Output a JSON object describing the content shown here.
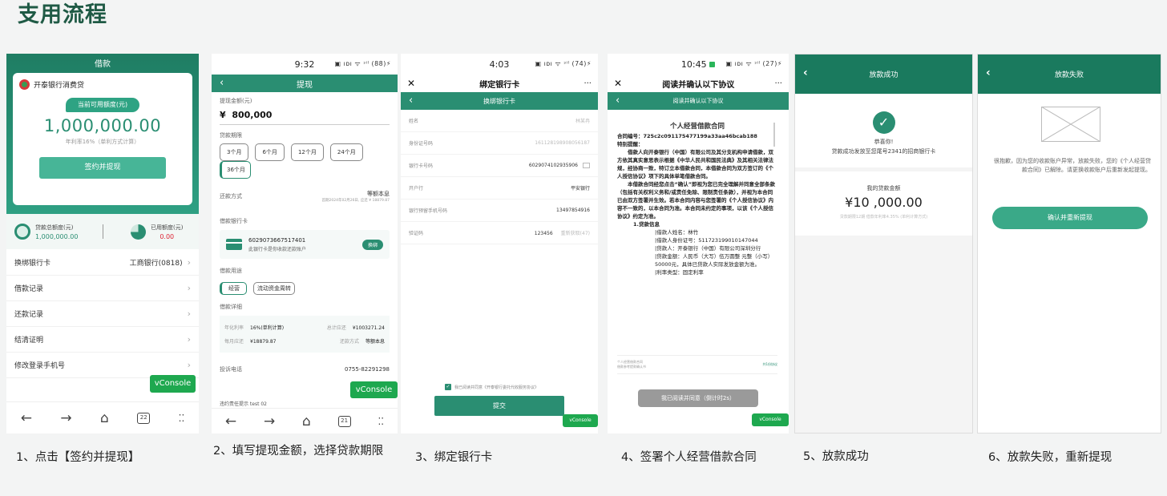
{
  "page_title": "支用流程",
  "captions": [
    "1、点击【签约并提现】",
    "2、填写提现金额，选择贷款期限",
    "3、绑定银行卡",
    "4、签署个人经营借款合同",
    "5、放款成功",
    "6、放款失败，重新提现"
  ],
  "vconsole": "vConsole",
  "p1": {
    "nav_title": "借款",
    "bank_name": "开泰银行消费贷",
    "quota_label": "当前可用额度(元)",
    "quota": "1,000,000.00",
    "rate_note": "年利率16%（单利方式计算）",
    "sign_button": "签约并提现",
    "total_label": "贷款总额度(元)",
    "total_value": "1,000,000.00",
    "used_label": "已用额度(元)",
    "used_value": "0.00",
    "menu": [
      {
        "label": "换绑银行卡",
        "value": "工商银行(0818)"
      },
      {
        "label": "借款记录",
        "value": ""
      },
      {
        "label": "还款记录",
        "value": ""
      },
      {
        "label": "结清证明",
        "value": ""
      },
      {
        "label": "修改登录手机号",
        "value": ""
      }
    ],
    "tab_count": "22"
  },
  "p2": {
    "time": "9:32",
    "status_right": "▣ ıᴅı ᯤ ᵌⁱˡ (88)⚡",
    "nav_title": "提现",
    "amount_label": "提现金额(元)",
    "currency": "¥",
    "amount": "800,000",
    "term_label": "贷款期限",
    "terms": [
      "3个月",
      "6个月",
      "12个月",
      "24个月",
      "36个月"
    ],
    "repay_label": "还款方式",
    "repay_value": "等额本息",
    "repay_note": "首期2024年02月26日, 应还 ¥ 18879.87",
    "card_label": "借款银行卡",
    "card_no": "6029073667517401",
    "card_note": "此银行卡是你收款还款账户",
    "card_btn": "换绑",
    "use_label": "借款用途",
    "uses": [
      "经营",
      "流动资金周转"
    ],
    "detail_label": "借款详细",
    "d_rate_l": "年化利率",
    "d_rate_v": "16%(单利计算)",
    "d_total_l": "总计应还",
    "d_total_v": "¥1003271.24",
    "d_month_l": "每月应还",
    "d_month_v": "¥18879.87",
    "d_way_l": "还款方式",
    "d_way_v": "等额本息",
    "phone_label": "投诉电话",
    "phone_value": "0755-82291298",
    "footer_note": "违约责任提示 test 02",
    "tab_count": "21"
  },
  "p3": {
    "time": "4:03",
    "status_right": "▣ ıᴅı ᯤ ᵌⁱˡ (74)⚡",
    "title": "绑定银行卡",
    "nav_title": "换绑银行卡",
    "fields": [
      {
        "label": "姓名",
        "value": "林某冉"
      },
      {
        "label": "身份证号码",
        "value": "161128198908056187"
      },
      {
        "label": "银行卡号码",
        "value": "6029074102935906"
      },
      {
        "label": "开户行",
        "value": "平安银行"
      },
      {
        "label": "银行预留手机号码",
        "value": "13497854916"
      },
      {
        "label": "验证码",
        "value": "123456"
      }
    ],
    "resend": "重新获取(47)",
    "agree": "我已阅读并同意《开泰银行委托代收服务协议》",
    "submit": "提交"
  },
  "p4": {
    "time": "10:45",
    "status_right": "▣ ıᴅı ᯤ ᵌⁱˡ (27)⚡",
    "title": "阅读并确认以下协议",
    "nav_title": "阅读并确认以下协议",
    "contract_title": "个人经营借款合同",
    "contract_no": "合同编号：725c2c091175477199a33aa46bcab188",
    "tip": "特别提醒：",
    "para1": "借款人向开泰银行（中国）有限公司及其分支机构申请借款，双方依其真实意思表示根据《中华人民共和国民法典》及其相关法律法规，经协商一致，特订立本借款合同，本借款合同为双方签订的《个人授信协议》项下的具体单笔借款合同。",
    "para2": "本借款合同经您点击“确认”即视为您已完全理解并同意全部条款（包括有关权利义务和/或责任免除、限制责任条款），并视为本合同已由双方签署并生效。若本合同内容与您签署的《个人授信协议》内容不一致的，以本合同为准。本合同未约定的事项，以该《个人授信协议》约定为准。",
    "sec1": "1.贷款信息",
    "items": [
      "|借款人姓名：林竹",
      "|借款人身份证号：511723199010147044",
      "|贷款人：开泰银行（中国）有限公司深圳分行",
      "|贷款金额：人民币（大写）伍万圆整 元整（小写）50000元，具体已贷款人实际发放金额为准。",
      "|利率类型：固定利率"
    ],
    "foot_left1": "个人经营借款合同",
    "foot_left2": "借款参考提款确认书",
    "foot_right": "共1份协议",
    "confirm": "我已阅读并同意（倒计时2s）"
  },
  "p5": {
    "nav_title": "放款成功",
    "congrats": "恭喜你!",
    "msg": "贷款成功发放至您尾号2341的招商银行卡",
    "my_label": "我的贷款金额",
    "amount": "¥10 ,000.00",
    "note": "贷款期限12期 借款年利率4.35% (单利计算方式)"
  },
  "p6": {
    "nav_title": "放款失败",
    "msg": "很抱歉，因为您的收款账户异常，放款失败，您的《个人经营贷款合同》已解除。请更换收款账户后重新发起提现。",
    "button": "确认并重新提现"
  }
}
